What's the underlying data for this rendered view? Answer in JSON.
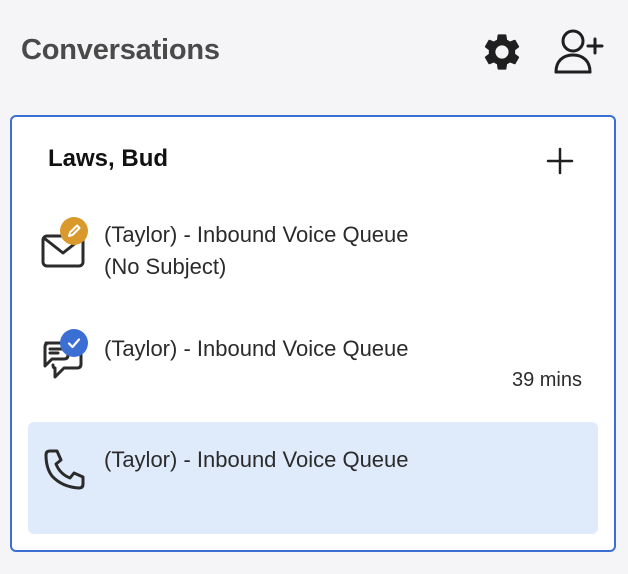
{
  "header": {
    "title": "Conversations",
    "settings_icon": "gear-icon",
    "add_user_icon": "add-user-icon"
  },
  "card": {
    "contact_name": "Laws, Bud",
    "add_icon": "plus-icon",
    "conversations": [
      {
        "type": "email",
        "icon": "envelope-icon",
        "badge": "pencil-icon",
        "badge_color": "#d9992d",
        "title": "(Taylor) - Inbound Voice Queue",
        "subtitle": "(No Subject)",
        "time": ""
      },
      {
        "type": "chat",
        "icon": "chat-bubbles-icon",
        "badge": "checkmark-icon",
        "badge_color": "#3b6fd4",
        "title": "(Taylor) - Inbound Voice Queue",
        "subtitle": "",
        "time": "39 mins"
      },
      {
        "type": "call",
        "icon": "phone-icon",
        "title": "(Taylor) - Inbound Voice Queue",
        "subtitle": "",
        "time": "",
        "selected": true
      }
    ]
  },
  "colors": {
    "accent": "#3b6fd4",
    "selected_bg": "#dfeafb",
    "title_text": "#4a4a4a"
  }
}
